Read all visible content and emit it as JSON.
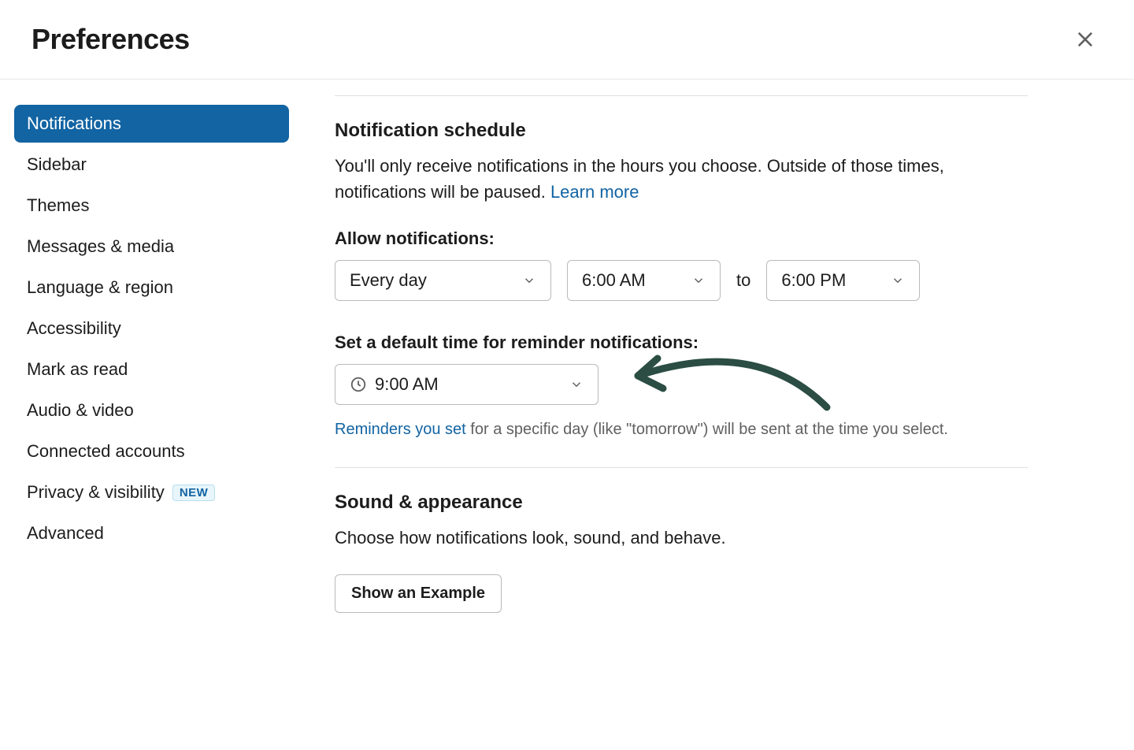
{
  "header": {
    "title": "Preferences"
  },
  "sidebar": {
    "items": [
      {
        "label": "Notifications",
        "active": true
      },
      {
        "label": "Sidebar"
      },
      {
        "label": "Themes"
      },
      {
        "label": "Messages & media"
      },
      {
        "label": "Language & region"
      },
      {
        "label": "Accessibility"
      },
      {
        "label": "Mark as read"
      },
      {
        "label": "Audio & video"
      },
      {
        "label": "Connected accounts"
      },
      {
        "label": "Privacy & visibility",
        "badge": "NEW"
      },
      {
        "label": "Advanced"
      }
    ]
  },
  "content": {
    "schedule": {
      "title": "Notification schedule",
      "desc1": "You'll only receive notifications in the hours you choose. Outside of those times, notifications will be paused. ",
      "learn_more": "Learn more",
      "allow_label": "Allow notifications:",
      "frequency": "Every day",
      "start_time": "6:00 AM",
      "to": "to",
      "end_time": "6:00 PM",
      "reminder_label": "Set a default time for reminder notifications:",
      "reminder_time": "9:00 AM",
      "helper_link": "Reminders you set",
      "helper_rest": " for a specific day (like \"tomorrow\") will be sent at the time you select."
    },
    "sound": {
      "title": "Sound & appearance",
      "desc": "Choose how notifications look, sound, and behave.",
      "example_btn": "Show an Example"
    }
  }
}
